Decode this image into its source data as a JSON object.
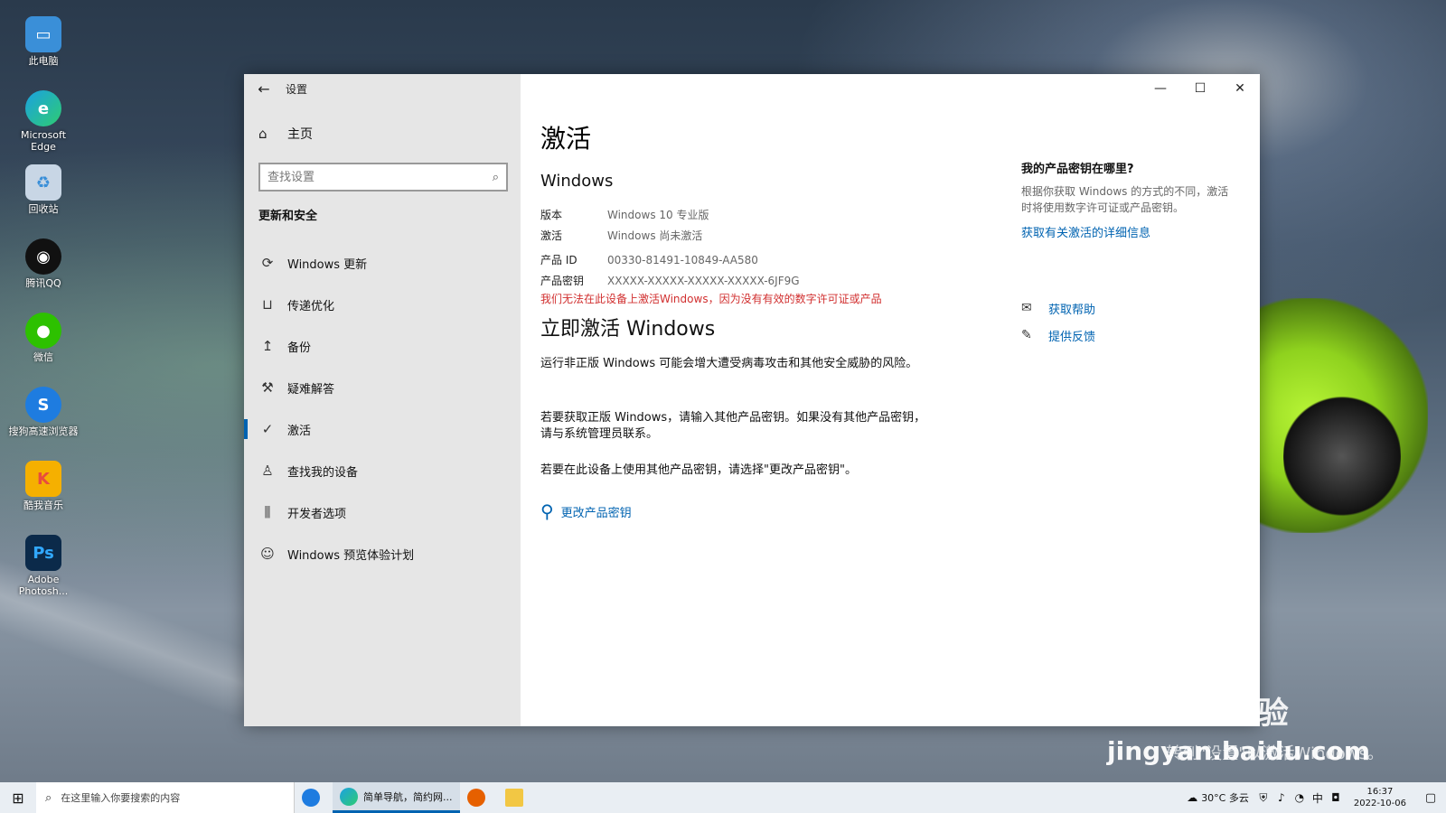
{
  "desktop": {
    "icons": [
      {
        "label": "此电脑",
        "icon": "computer-icon",
        "color": "#3a8fd8"
      },
      {
        "label": "Microsoft Edge",
        "icon": "edge-icon",
        "color": "#1ba1e2"
      },
      {
        "label": "回收站",
        "icon": "recycle-bin-icon",
        "color": "#8aa5c0"
      },
      {
        "label": "腾讯QQ",
        "icon": "qq-icon",
        "color": "#111111"
      },
      {
        "label": "微信",
        "icon": "wechat-icon",
        "color": "#2dc100"
      },
      {
        "label": "搜狗高速浏览器",
        "icon": "sogou-icon",
        "color": "#1e7ce0"
      },
      {
        "label": "酷我音乐",
        "icon": "kuwo-icon",
        "color": "#f5b000"
      },
      {
        "label": "Adobe Photosh...",
        "icon": "photoshop-icon",
        "color": "#0b2a4a"
      }
    ]
  },
  "window": {
    "title": "设置",
    "controls": {
      "minimize": "—",
      "maximize": "☐",
      "close": "✕"
    }
  },
  "sidebar": {
    "home_label": "主页",
    "search_placeholder": "查找设置",
    "section_title": "更新和安全",
    "items": [
      {
        "label": "Windows 更新",
        "icon": "sync-icon"
      },
      {
        "label": "传递优化",
        "icon": "delivery-icon"
      },
      {
        "label": "备份",
        "icon": "backup-icon"
      },
      {
        "label": "疑难解答",
        "icon": "wrench-icon"
      },
      {
        "label": "激活",
        "icon": "check-circle-icon",
        "active": true
      },
      {
        "label": "查找我的设备",
        "icon": "find-device-icon"
      },
      {
        "label": "开发者选项",
        "icon": "developer-icon"
      },
      {
        "label": "Windows 预览体验计划",
        "icon": "insider-icon"
      }
    ]
  },
  "main": {
    "title": "激活",
    "subtitle": "Windows",
    "info": {
      "edition_label": "版本",
      "edition_value": "Windows 10 专业版",
      "activation_label": "激活",
      "activation_value": "Windows 尚未激活",
      "product_id_label": "产品 ID",
      "product_id_value": "00330-81491-10849-AA580",
      "product_key_label": "产品密钥",
      "product_key_value": "XXXXX-XXXXX-XXXXX-XXXXX-6JF9G"
    },
    "warning": "我们无法在此设备上激活Windows，因为没有有效的数字许可证或产品",
    "activate_heading": "立即激活 Windows",
    "para1": "运行非正版 Windows 可能会增大遭受病毒攻击和其他安全威胁的风险。",
    "para2": "若要获取正版 Windows，请输入其他产品密钥。如果没有其他产品密钥，请与系统管理员联系。",
    "para3": "若要在此设备上使用其他产品密钥，请选择\"更改产品密钥\"。",
    "change_key_label": "更改产品密钥"
  },
  "side_panel": {
    "heading": "我的产品密钥在哪里?",
    "description": "根据你获取 Windows 的方式的不同，激活时将使用数字许可证或产品密钥。",
    "link": "获取有关激活的详细信息",
    "help_label": "获取帮助",
    "feedback_label": "提供反馈"
  },
  "watermark": {
    "brand": "Bai du 经验",
    "url": "jingyan.baidu.com",
    "caption": "转到\"设置\"以激活Windows。"
  },
  "taskbar": {
    "search_placeholder": "在这里输入你要搜索的内容",
    "app_running_label": "简单导航，简约网...",
    "weather": "30°C 多云",
    "time": "16:37",
    "date": "2022-10-06"
  },
  "colors": {
    "accent": "#0063b1",
    "warning": "#d12f2f",
    "sidebar_bg": "#e6e6e6"
  }
}
